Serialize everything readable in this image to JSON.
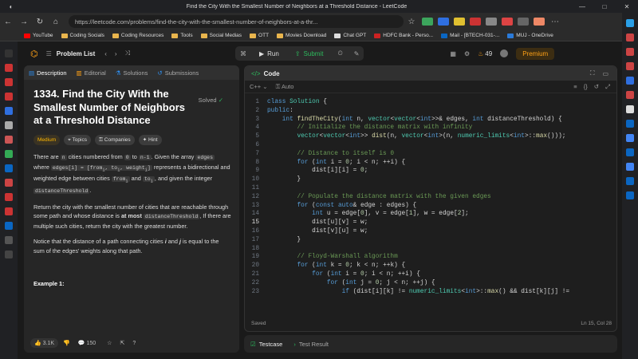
{
  "window": {
    "title": "Find the City With the Smallest Number of Neighbors at a Threshold Distance - LeetCode"
  },
  "browser": {
    "url": "https://leetcode.com/problems/find-the-city-with-the-smallest-number-of-neighbors-at-a-thr..."
  },
  "bookmarks": [
    "YouTube",
    "Coding Socials",
    "Coding Resources",
    "Tools",
    "Social Medias",
    "OTT",
    "Movies Download",
    "Chat GPT",
    "HDFC Bank - Perso...",
    "Mail - [BTECH-031-...",
    "MUJ - OneDrive"
  ],
  "header": {
    "problem_list": "Problem List",
    "run": "Run",
    "submit": "Submit",
    "streak": "49",
    "premium": "Premium"
  },
  "left_tabs": [
    "Description",
    "Editorial",
    "Solutions",
    "Submissions"
  ],
  "problem": {
    "title": "1334. Find the City With the Smallest Number of Neighbors at a Threshold Distance",
    "solved": "Solved",
    "tags": [
      "Medium",
      "Topics",
      "Companies",
      "Hint"
    ],
    "p1a": "There are ",
    "p1b": "n",
    "p1c": " cities numbered from ",
    "p1d": "0",
    "p1e": " to ",
    "p1f": "n-1",
    "p1g": ". Given the array ",
    "p1h": "edges",
    "p1i": " where ",
    "p1j": "edges[i] = [from",
    "p1k": ", to",
    "p1l": ", weight",
    "p1m": "]",
    "p1n": " represents a bidirectional and weighted edge between cities ",
    "p1o": "from",
    "p1p": " and ",
    "p1q": "to",
    "p1r": ", and given the integer ",
    "p1s": "distanceThreshold",
    "p1t": ".",
    "p2a": "Return the city with the smallest number of cities that are reachable through some path and whose distance is ",
    "p2b": "at most",
    "p2c": "distanceThreshold",
    "p2d": ", If there are multiple such cities, return the city with the greatest number.",
    "p3a": "Notice that the distance of a path connecting cities ",
    "p3b": "i",
    "p3c": " and ",
    "p3d": "j",
    "p3e": " is equal to the sum of the edges' weights along that path.",
    "example": "Example 1:"
  },
  "footer": {
    "likes": "3.1K",
    "comments": "150"
  },
  "code_panel": {
    "title": "Code",
    "language": "C++",
    "mode": "Auto",
    "status": "Saved",
    "cursor": "Ln 15, Col 28"
  },
  "code_lines": [
    "class Solution {",
    "public:",
    "    int findTheCity(int n, vector<vector<int>>& edges, int distanceThreshold) {",
    "        // Initialize the distance matrix with infinity",
    "        vector<vector<int>> dist(n, vector<int>(n, numeric_limits<int>::max()));",
    "",
    "        // Distance to itself is 0",
    "        for (int i = 0; i < n; ++i) {",
    "            dist[i][i] = 0;",
    "        }",
    "",
    "        // Populate the distance matrix with the given edges",
    "        for (const auto& edge : edges) {",
    "            int u = edge[0], v = edge[1], w = edge[2];",
    "            dist[u][v] = w;",
    "            dist[v][u] = w;",
    "        }",
    "",
    "        // Floyd-Warshall algorithm",
    "        for (int k = 0; k < n; ++k) {",
    "            for (int i = 0; i < n; ++i) {",
    "                for (int j = 0; j < n; ++j) {",
    "                    if (dist[i][k] != numeric_limits<int>::max() && dist[k][j] !="
  ],
  "test_panel": {
    "testcase": "Testcase",
    "result": "Test Result"
  }
}
